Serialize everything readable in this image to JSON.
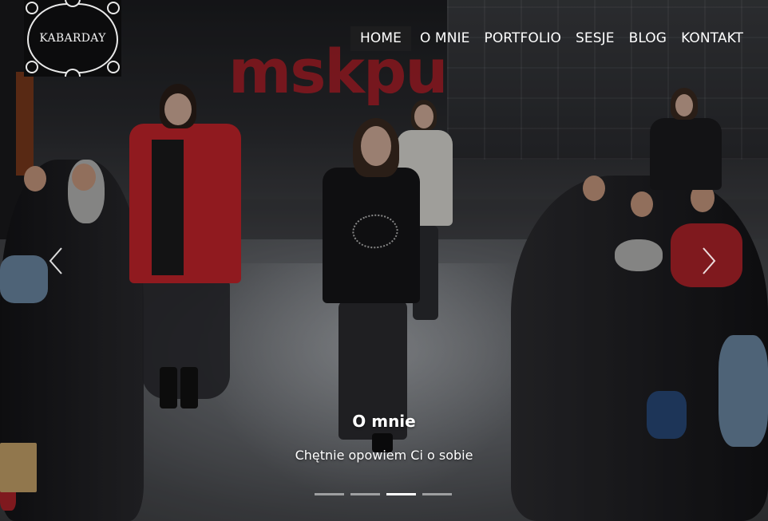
{
  "logo": {
    "text": "KABARDAY",
    "icon": "ornamental-frame-icon"
  },
  "nav": {
    "items": [
      {
        "label": "HOME",
        "active": true
      },
      {
        "label": "O MNIE",
        "active": false
      },
      {
        "label": "PORTFOLIO",
        "active": false
      },
      {
        "label": "SESJE",
        "active": false
      },
      {
        "label": "BLOG",
        "active": false
      },
      {
        "label": "KONTAKT",
        "active": false
      }
    ]
  },
  "carousel": {
    "prev_icon": "chevron-left-icon",
    "next_icon": "chevron-right-icon",
    "slide": {
      "title": "O mnie",
      "subtitle": "Chętnie opowiem Ci o sobie",
      "background_sign_text": "mskpu"
    },
    "indicator_count": 4,
    "active_index": 2
  },
  "colors": {
    "nav_active_bg": "#1e1e20",
    "text": "#ffffff",
    "sign_red": "#b2202a"
  }
}
